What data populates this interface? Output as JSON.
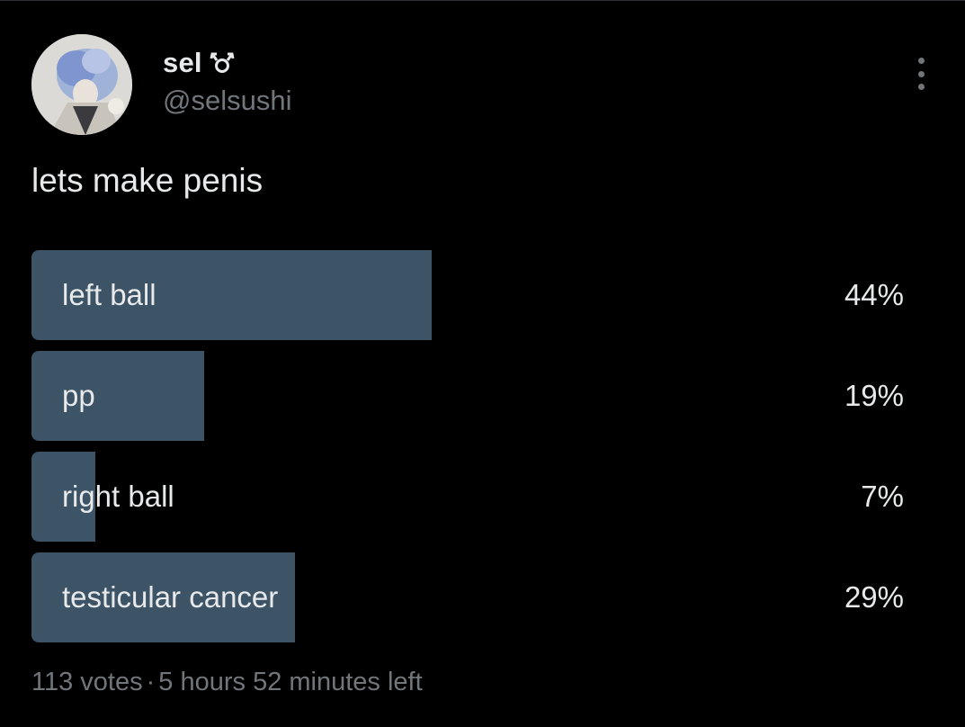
{
  "author": {
    "display_name": "sel",
    "handle": "@selsushi",
    "badge_icon": "gender-symbol-icon"
  },
  "more_icon": "more-options-icon",
  "tweet": {
    "text": "lets make penis"
  },
  "poll": {
    "bar_color": "#3d5467",
    "options": [
      {
        "label": "left ball",
        "percent_text": "44%",
        "percent": 44
      },
      {
        "label": "pp",
        "percent_text": "19%",
        "percent": 19
      },
      {
        "label": "right ball",
        "percent_text": "7%",
        "percent": 7
      },
      {
        "label": "testicular cancer",
        "percent_text": "29%",
        "percent": 29
      }
    ],
    "votes": "113 votes",
    "separator": "·",
    "time_left": "5 hours 52 minutes left"
  }
}
